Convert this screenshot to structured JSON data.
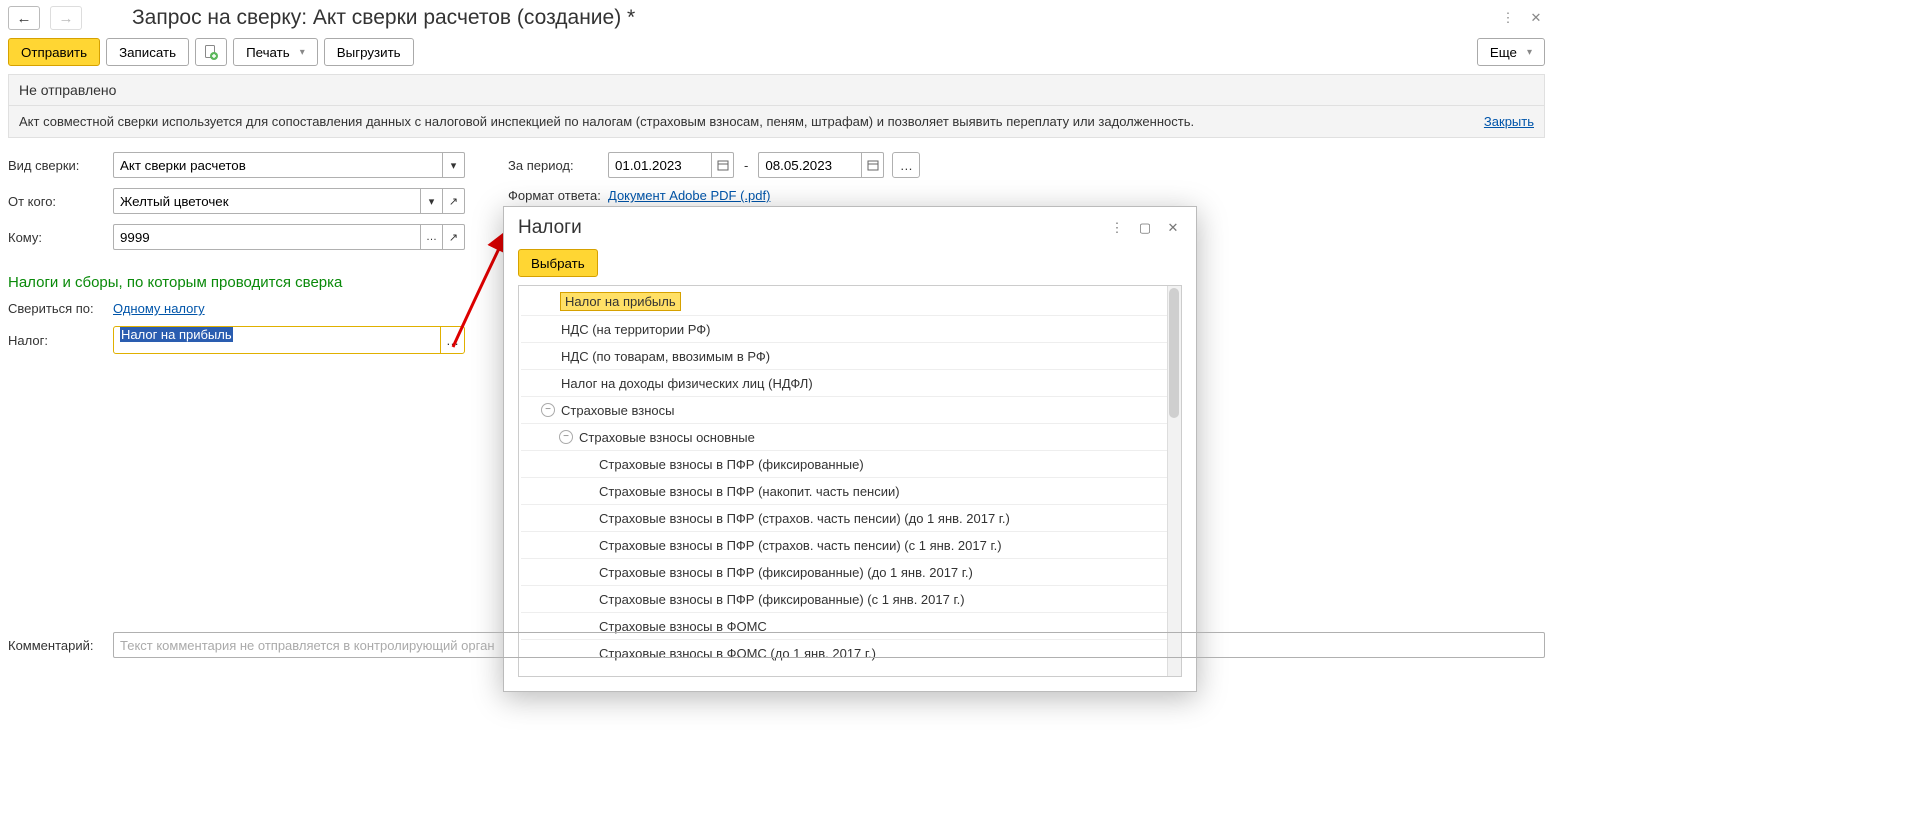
{
  "title": "Запрос на сверку: Акт сверки расчетов (создание) *",
  "toolbar": {
    "send": "Отправить",
    "save": "Записать",
    "print": "Печать",
    "export": "Выгрузить",
    "more": "Еще"
  },
  "status": "Не отправлено",
  "info_text": "Акт совместной сверки используется для сопоставления данных с налоговой инспекцией по налогам (страховым взносам, пеням, штрафам) и позволяет выявить переплату или задолженность.",
  "close_link": "Закрыть",
  "labels": {
    "vid": "Вид сверки:",
    "ot_kogo": "От кого:",
    "komu": "Кому:",
    "za_period": "За период:",
    "dash": "-",
    "format": "Формат ответа:",
    "sver_po": "Свериться по:",
    "nalog": "Налог:",
    "comment": "Комментарий:"
  },
  "values": {
    "vid": "Акт сверки расчетов",
    "ot_kogo": "Желтый цветочек",
    "komu": "9999",
    "date_from": "01.01.2023",
    "date_to": "08.05.2023",
    "format_link": "Документ Adobe PDF (.pdf)",
    "sver_po_link": "Одному налогу",
    "nalog": "Налог на прибыль",
    "comment_placeholder": "Текст комментария не отправляется в контролирующий орган"
  },
  "green_heading": "Налоги и сборы, по которым проводится сверка",
  "popup": {
    "title": "Налоги",
    "select_btn": "Выбрать",
    "items": [
      {
        "label": "Налог на прибыль",
        "indent": 0,
        "toggle": "",
        "selected": true
      },
      {
        "label": "НДС (на территории РФ)",
        "indent": 0,
        "toggle": ""
      },
      {
        "label": "НДС (по товарам, ввозимым в РФ)",
        "indent": 0,
        "toggle": ""
      },
      {
        "label": "Налог на доходы физических лиц (НДФЛ)",
        "indent": 0,
        "toggle": ""
      },
      {
        "label": "Страховые взносы",
        "indent": 0,
        "toggle": "minus"
      },
      {
        "label": "Страховые взносы основные",
        "indent": 1,
        "toggle": "minus"
      },
      {
        "label": "Страховые взносы в ПФР  (фиксированные)",
        "indent": 2,
        "toggle": ""
      },
      {
        "label": "Страховые взносы в ПФР (накопит. часть пенсии)",
        "indent": 2,
        "toggle": ""
      },
      {
        "label": "Страховые взносы в ПФР (страхов. часть пенсии) (до 1 янв. 2017 г.)",
        "indent": 2,
        "toggle": ""
      },
      {
        "label": "Страховые взносы в ПФР (страхов. часть пенсии) (с 1 янв. 2017 г.)",
        "indent": 2,
        "toggle": ""
      },
      {
        "label": "Страховые взносы в ПФР (фиксированные) (до 1 янв. 2017 г.)",
        "indent": 2,
        "toggle": ""
      },
      {
        "label": "Страховые взносы в ПФР (фиксированные) (с 1 янв. 2017 г.)",
        "indent": 2,
        "toggle": ""
      },
      {
        "label": "Страховые взносы в ФОМС",
        "indent": 2,
        "toggle": ""
      },
      {
        "label": "Страховые взносы в ФОМС (до 1 янв. 2017 г.)",
        "indent": 2,
        "toggle": ""
      }
    ]
  }
}
